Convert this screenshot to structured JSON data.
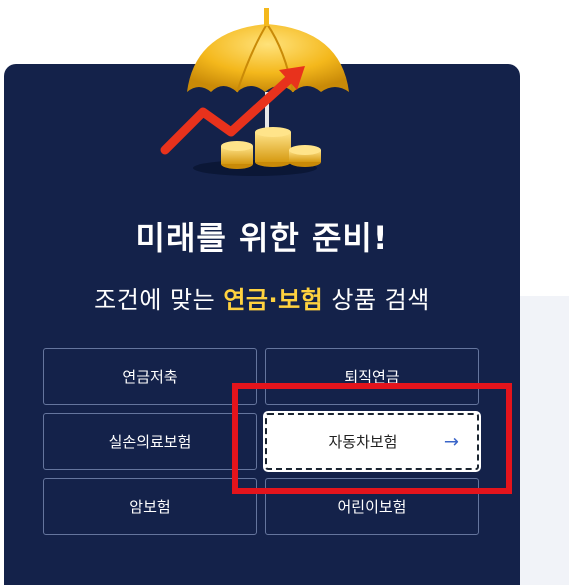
{
  "panel": {
    "title": "미래를 위한 준비!",
    "subtitle_prefix": "조건에 맞는 ",
    "subtitle_highlight": "연금·보험",
    "subtitle_suffix": " 상품 검색"
  },
  "buttons": [
    {
      "label": "연금저축"
    },
    {
      "label": "퇴직연금"
    },
    {
      "label": "실손의료보험"
    },
    {
      "label": "자동차보험",
      "arrow": "→"
    },
    {
      "label": "암보험"
    },
    {
      "label": "어린이보험"
    }
  ],
  "colors": {
    "card_bg": "#14224a",
    "highlight_text": "#ffd23f",
    "annotation_red": "#e3141c",
    "side_panel": "#f1f3f8"
  },
  "icons": {
    "illustration": "umbrella-coins-growth-icon",
    "arrow": "right-arrow-icon"
  }
}
